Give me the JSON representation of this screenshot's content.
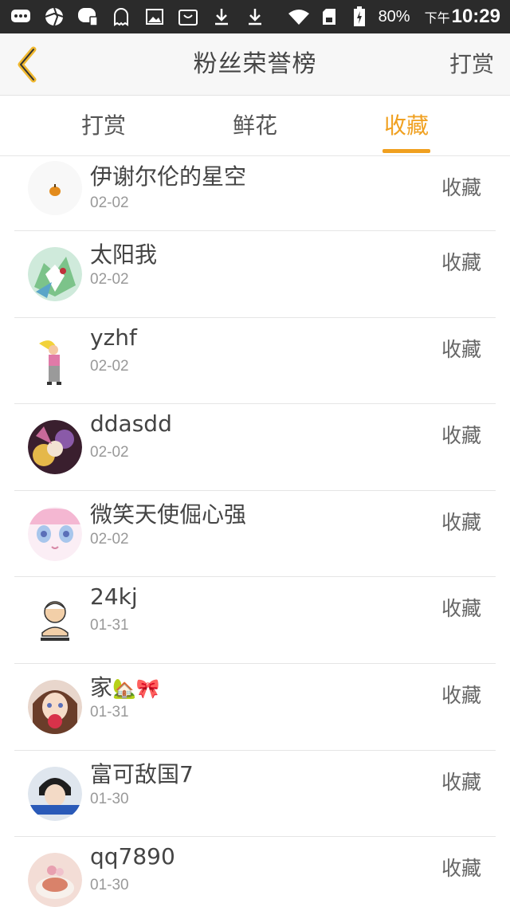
{
  "status_bar": {
    "battery": "80%",
    "ampm": "下午",
    "time": "10:29",
    "icons": [
      "chat-icon",
      "aperture-icon",
      "line-icon",
      "ghost-icon",
      "image-icon",
      "shopping-icon",
      "download-icon",
      "download-icon",
      "wifi-icon",
      "sim-icon",
      "battery-icon"
    ]
  },
  "header": {
    "title": "粉丝荣誉榜",
    "action_label": "打赏",
    "accent_color": "#f0a020"
  },
  "tabs": [
    {
      "label": "打赏",
      "active": false
    },
    {
      "label": "鲜花",
      "active": false
    },
    {
      "label": "收藏",
      "active": true
    }
  ],
  "fans": [
    {
      "name": "伊谢尔伦的星空",
      "date": "02-02",
      "action": "收藏"
    },
    {
      "name": "太阳我",
      "date": "02-02",
      "action": "收藏"
    },
    {
      "name": "yzhf",
      "date": "02-02",
      "action": "收藏"
    },
    {
      "name": "ddasdd",
      "date": "02-02",
      "action": "收藏"
    },
    {
      "name": "微笑天使倔心强",
      "date": "02-02",
      "action": "收藏"
    },
    {
      "name": "24kj",
      "date": "01-31",
      "action": "收藏"
    },
    {
      "name": "家",
      "name_emoji": "🏡🎀",
      "date": "01-31",
      "action": "收藏"
    },
    {
      "name": "富可敌国7",
      "date": "01-30",
      "action": "收藏"
    },
    {
      "name": "qq7890",
      "date": "01-30",
      "action": "收藏"
    }
  ]
}
